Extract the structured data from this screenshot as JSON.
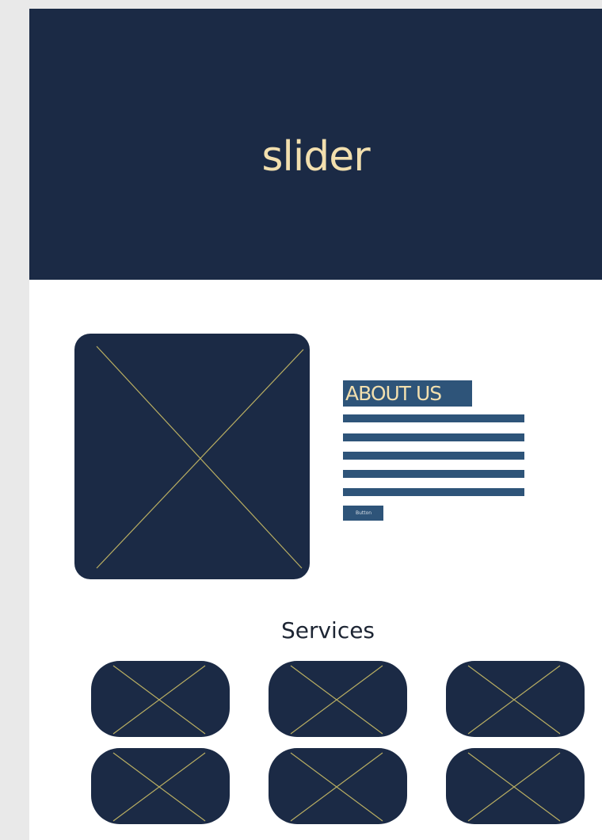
{
  "hero": {
    "title": "slider"
  },
  "about": {
    "heading": "ABOUT US",
    "button_label": "Button",
    "image_icon": "image-placeholder-icon"
  },
  "services": {
    "title": "Services",
    "card_icon": "image-placeholder-icon",
    "card_count": 6
  },
  "colors": {
    "background": "#e9e9e9",
    "page": "#ffffff",
    "navy": "#1b2a45",
    "accent_blue": "#2e5479",
    "cream": "#f2dfae",
    "placeholder_line": "#b9ae62"
  }
}
